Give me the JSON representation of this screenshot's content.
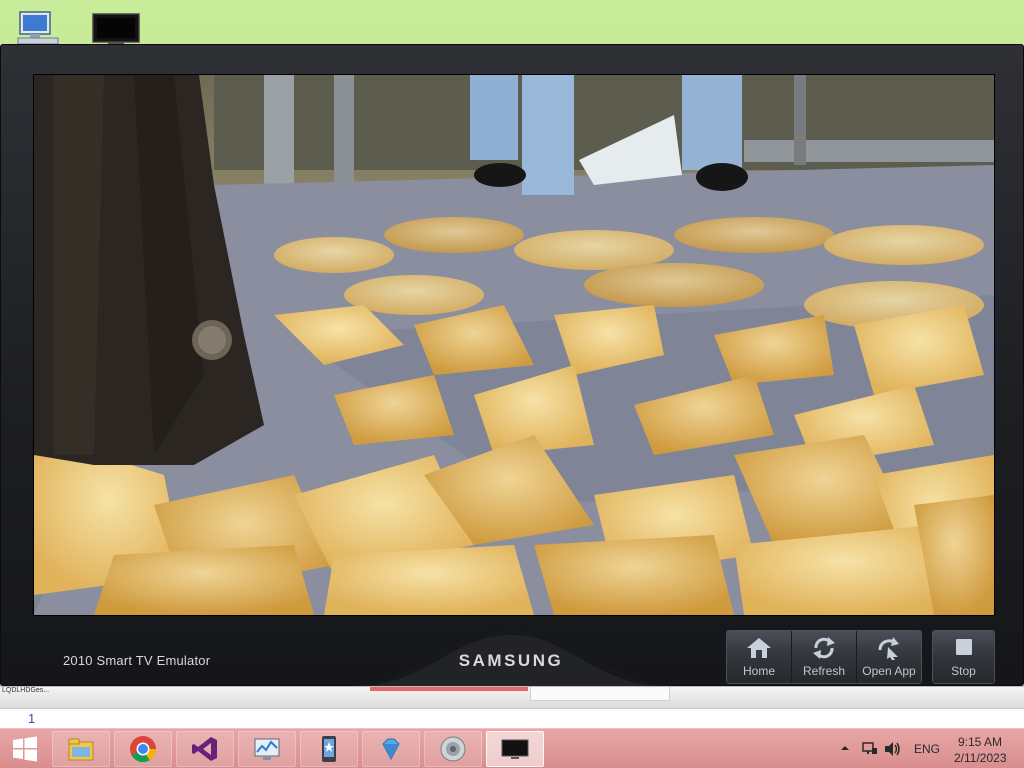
{
  "desktop": {
    "icons": [
      {
        "name": "computer-icon"
      },
      {
        "name": "tv-monitor-icon"
      }
    ]
  },
  "emulator": {
    "title": "2010 Smart TV Emulator",
    "brand": "SAMSUNG",
    "screen_content": "photo of fallen yellow ginkgo leaves on a path",
    "buttons": {
      "home": "Home",
      "refresh": "Refresh",
      "open_app": "Open App",
      "stop": "Stop"
    }
  },
  "strip": {
    "text": "LQDLHDGes..."
  },
  "text_field": {
    "value": "1"
  },
  "taskbar": {
    "apps": [
      {
        "name": "file-explorer-icon",
        "state": "pinned"
      },
      {
        "name": "chrome-icon",
        "state": "pinned"
      },
      {
        "name": "visual-studio-icon",
        "state": "pinned"
      },
      {
        "name": "performance-monitor-icon",
        "state": "pinned"
      },
      {
        "name": "windows-phone-icon",
        "state": "pinned"
      },
      {
        "name": "diamond-app-icon",
        "state": "pinned"
      },
      {
        "name": "speaker-app-icon",
        "state": "pinned"
      },
      {
        "name": "tv-emulator-icon",
        "state": "active"
      }
    ],
    "tray": {
      "language": "ENG",
      "time": "9:15 AM",
      "date": "2/11/2023"
    }
  },
  "colors": {
    "desktop": "#b4e07f",
    "emulator_body": "#1c1d21",
    "taskbar": "#d98e8e"
  }
}
